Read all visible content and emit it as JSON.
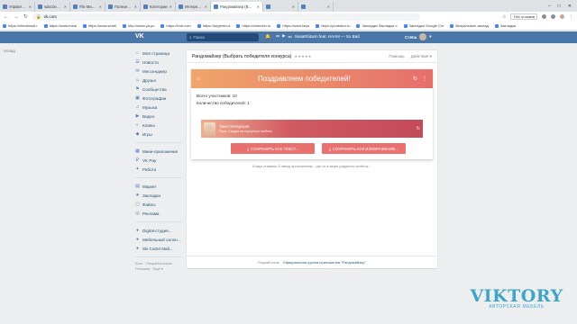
{
  "browser": {
    "tabs": [
      {
        "title": "Управление MySQL | Пан",
        "active": false
      },
      {
        "title": "sdar.beget.com / localho",
        "active": false
      },
      {
        "title": "File Manager - Beget",
        "active": false
      },
      {
        "title": "Полезные статьи. Подели",
        "active": false
      },
      {
        "title": "Категории",
        "active": false
      },
      {
        "title": "Интернет магазин Opencart",
        "active": false
      },
      {
        "title": "Рандомайзер (Выбрать",
        "active": true
      },
      {
        "title": "",
        "active": false
      },
      {
        "title": "",
        "active": false
      }
    ],
    "url": "vk.com",
    "extension_chip": "ТАК отзывов",
    "bookmarks": [
      "https://checktrust.r",
      "https://www.mirai",
      "https://www.seobi",
      "http://www.ya.pu",
      "https://tmtr.com",
      "https://turgenev.a",
      "https://anerekin.ru",
      "https://www.keys",
      "https://prodakor.ru",
      "Закладки Закладки о",
      "Закладки Google Chr",
      "Визуальные заклад",
      "Закладки"
    ]
  },
  "vk": {
    "logo": "VK",
    "search_placeholder": "Поиск",
    "player_track": "SeaaRbitarin feat. HAAM — So Bad",
    "user_name": "Стёпа"
  },
  "left_status": "Назад",
  "sidebar": {
    "group1": [
      "Моя страница",
      "Новости",
      "Мессенджер",
      "Друзья",
      "Сообщества",
      "Фотографии",
      "Музыка",
      "Видео",
      "Клипы",
      "Игры"
    ],
    "group2": [
      "Мини-приложения",
      "VK Pay",
      "Работа"
    ],
    "group3": [
      "Маркет",
      "Закладки",
      "Файлы",
      "Реклама"
    ],
    "group4": [
      "Digital-студия...",
      "Мебельный салон...",
      "Ski Cartel Mall..."
    ],
    "footer": "Блог · Разработчикам\nРеклама · Ещё ▾"
  },
  "app": {
    "title": "Рандомайзер (Выбрать победителя конкурса)",
    "stars": "★★★★★",
    "help": "Помощь",
    "actions": "Действия ▾",
    "banner_title": "Поздравляем победителей!",
    "participants": "Всего участников: 10",
    "winners_count": "Количество победителей: 1",
    "winner_name": "Таня Печерская",
    "winner_sub": "Приз: Скидка на корпусную мебель",
    "save_text": "СОХРАНИТЬ КАК ТЕКСТ...",
    "save_image": "СОХРАНИТЬ КАК ИЗОБРАЖЕНИЕ...",
    "hint": "Когда ставишь 5 звезд приложению - где-то в мире радуется котёнок...",
    "footer_label": "Разработчик:",
    "footer_link": "Официальная группа приложения \"Рандомайзер\""
  },
  "watermark": {
    "big": "VIKTORY",
    "small": "АВТОРСКАЯ МЕБЕЛЬ"
  }
}
